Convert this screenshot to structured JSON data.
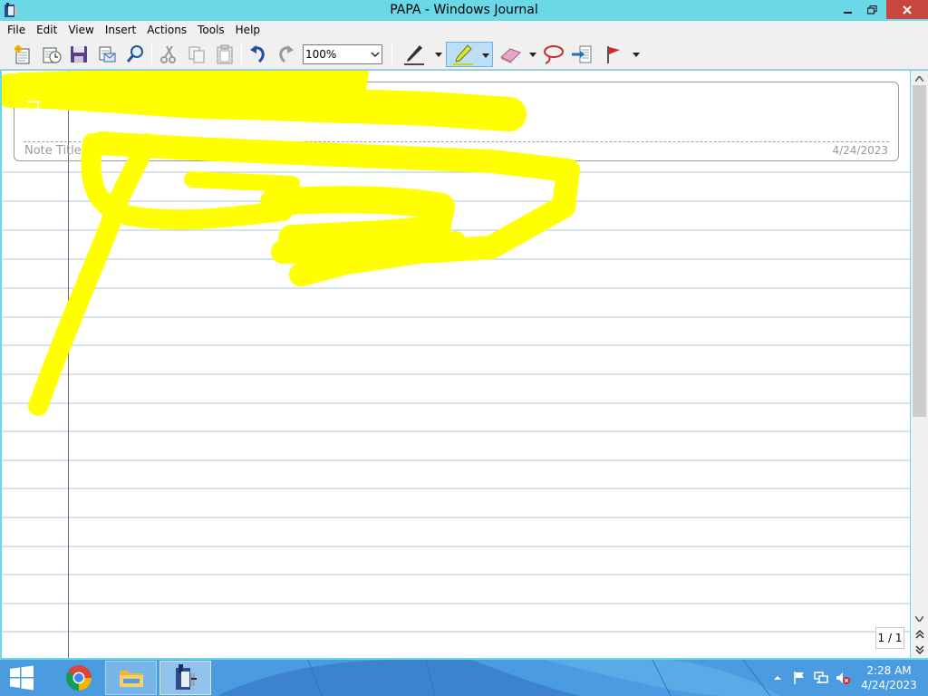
{
  "window": {
    "title": "PAPA - Windows Journal",
    "icon": "journal-app-icon",
    "controls": [
      "minimize-icon",
      "restore-icon",
      "close-icon"
    ]
  },
  "menu": [
    "File",
    "Edit",
    "View",
    "Insert",
    "Actions",
    "Tools",
    "Help"
  ],
  "toolbar": {
    "buttons": [
      "new-note-icon",
      "open-recent-icon",
      "save-icon",
      "send-icon",
      "find-icon",
      "cut-icon",
      "copy-icon",
      "paste-icon",
      "undo-icon",
      "redo-icon",
      "pen-icon",
      "highlighter-icon",
      "eraser-icon",
      "lasso-icon",
      "insert-space-icon",
      "flag-icon"
    ],
    "zoom": "100%",
    "active_tool": "highlighter"
  },
  "note": {
    "title_placeholder": "Note Title",
    "date": "4/24/2023",
    "ink_color": "#ffff00"
  },
  "page_indicator": "1 / 1",
  "taskbar": {
    "apps": [
      "start-icon",
      "chrome-icon",
      "file-explorer-icon",
      "windows-journal-icon"
    ],
    "tray": [
      "show-hidden-icons-icon",
      "action-center-flag-icon",
      "network-icon",
      "volume-muted-icon"
    ],
    "time": "2:28 AM",
    "date": "4/24/2023"
  },
  "colors": {
    "titlebar": "#6ad8e6",
    "close": "#c7473f",
    "rule_line": "#a8c7d8",
    "margin_line": "#7f5f86",
    "taskbar": "#4d9de0"
  }
}
